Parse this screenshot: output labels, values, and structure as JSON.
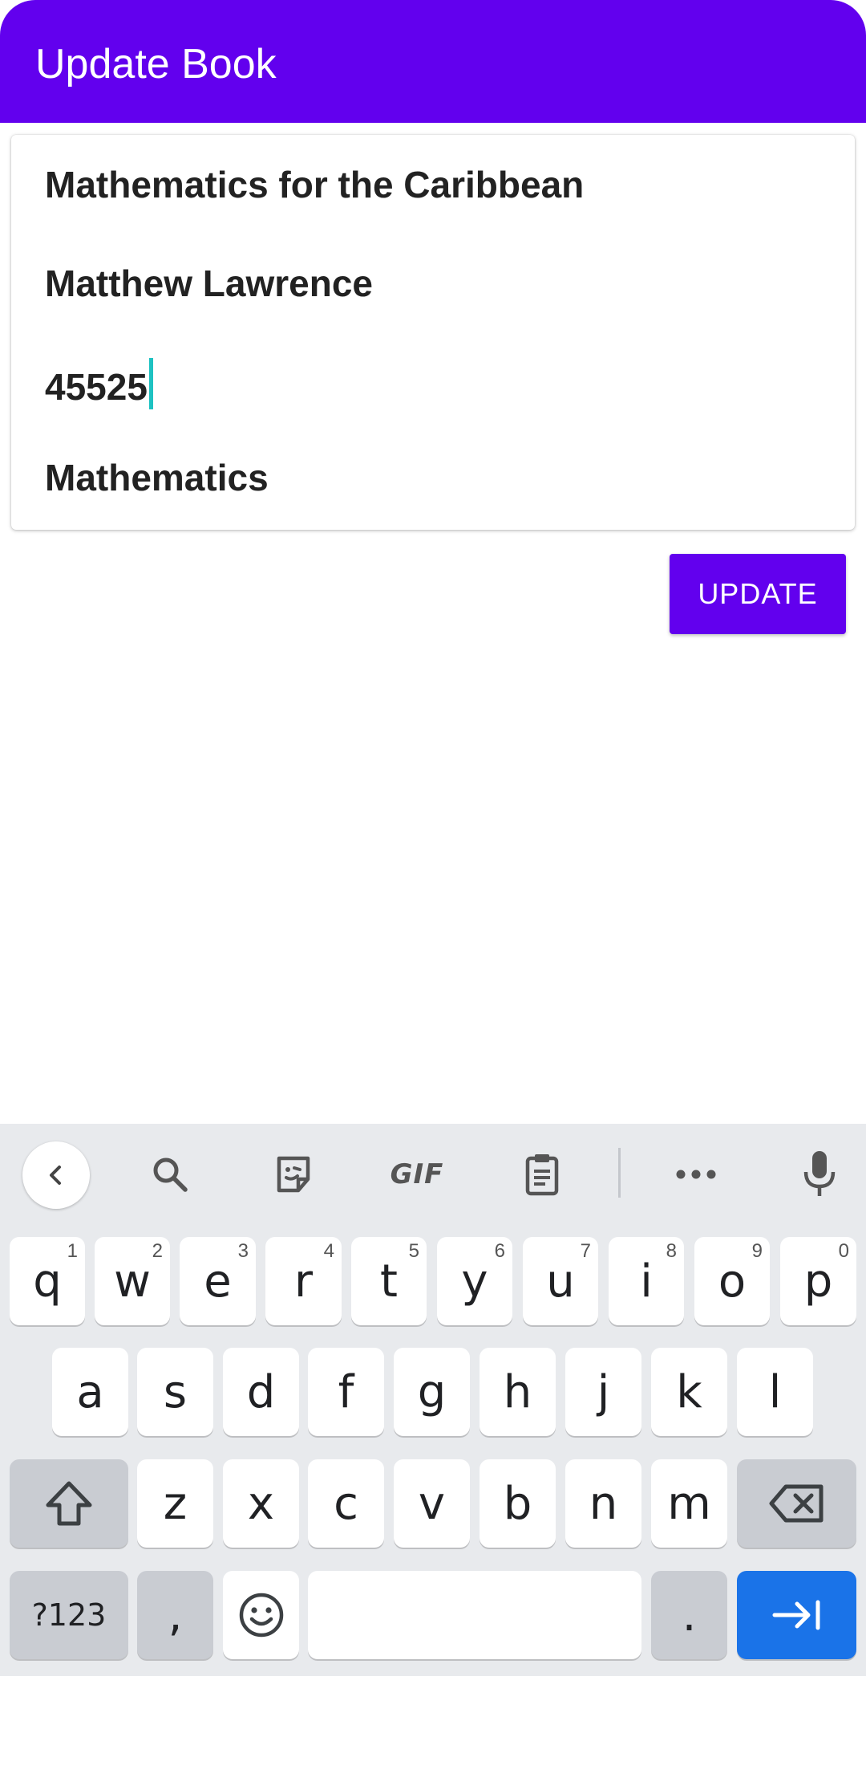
{
  "appbar": {
    "title": "Update Book"
  },
  "form": {
    "title_value": "Mathematics for the Caribbean",
    "author_value": "Matthew Lawrence",
    "number_value": "45525",
    "subject_value": "Mathematics"
  },
  "update_button": {
    "label": "UPDATE"
  },
  "colors": {
    "primary": "#6200ee",
    "caret": "#1ec2c2",
    "keyboard_bg": "#e8eaed",
    "action_key": "#1a73e8"
  },
  "keyboard": {
    "toolbar": {
      "gif_label": "GIF",
      "icons": [
        "chevron-left-icon",
        "search-icon",
        "sticker-icon",
        "gif-icon",
        "clipboard-icon",
        "more-icon",
        "mic-icon"
      ]
    },
    "row1": [
      {
        "key": "q",
        "hint": "1"
      },
      {
        "key": "w",
        "hint": "2"
      },
      {
        "key": "e",
        "hint": "3"
      },
      {
        "key": "r",
        "hint": "4"
      },
      {
        "key": "t",
        "hint": "5"
      },
      {
        "key": "y",
        "hint": "6"
      },
      {
        "key": "u",
        "hint": "7"
      },
      {
        "key": "i",
        "hint": "8"
      },
      {
        "key": "o",
        "hint": "9"
      },
      {
        "key": "p",
        "hint": "0"
      }
    ],
    "row2": [
      "a",
      "s",
      "d",
      "f",
      "g",
      "h",
      "j",
      "k",
      "l"
    ],
    "row3": [
      "z",
      "x",
      "c",
      "v",
      "b",
      "n",
      "m"
    ],
    "symbols_label": "?123",
    "comma_label": ",",
    "period_label": "."
  }
}
